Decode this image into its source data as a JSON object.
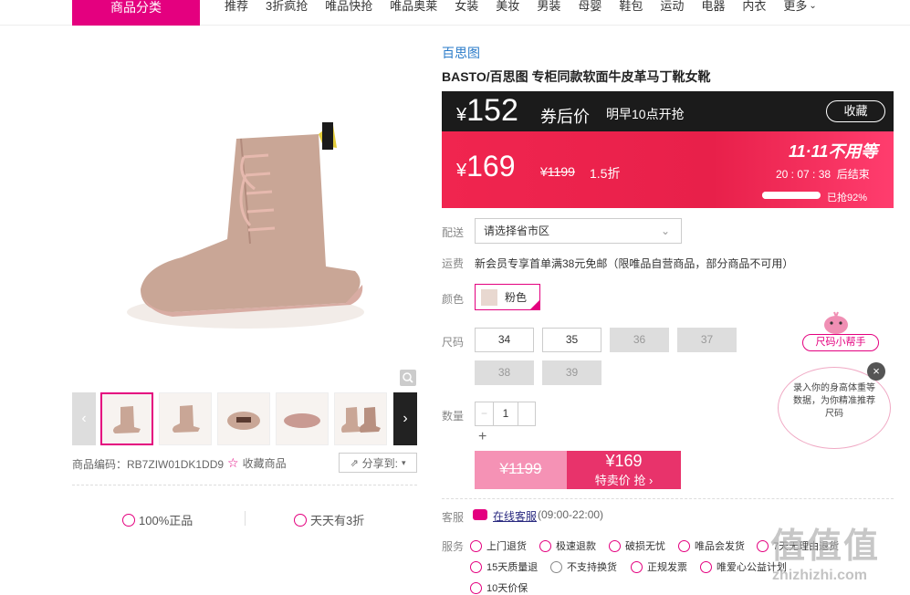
{
  "nav": {
    "category_button": "商品分类",
    "links": [
      "推荐",
      "3折疯抢",
      "唯品快抢",
      "唯品奥莱",
      "女装",
      "美妆",
      "男装",
      "母婴",
      "鞋包",
      "运动",
      "电器",
      "内衣",
      "更多"
    ]
  },
  "product": {
    "brand": "百思图",
    "title": "BASTO/百思图 专柜同款软面牛皮革马丁靴女靴",
    "code_label": "商品编码：",
    "code": "RB7ZIW01DK1DD9",
    "favorite_label": "收藏商品",
    "share_label": "分享到:"
  },
  "price": {
    "coupon_price": "152",
    "coupon_label": "券后价",
    "coupon_start": "明早10点开抢",
    "favorite_btn": "收藏",
    "current_price": "169",
    "currency": "¥",
    "original_price": "¥1199",
    "discount": "1.5折",
    "event_title": "11·11不用等",
    "countdown": "20 : 07 : 38",
    "countdown_suffix": "后结束",
    "sold_label": "已抢92%",
    "sold_fraction": 0.92
  },
  "guarantees": [
    "100%正品",
    "天天有3折"
  ],
  "delivery": {
    "label": "配送",
    "placeholder": "请选择省市区"
  },
  "shipping": {
    "label": "运费",
    "text": "新会员专享首单满38元免邮（限唯品自营商品，部分商品不可用）"
  },
  "color": {
    "label": "颜色",
    "selected": "粉色"
  },
  "sizes": {
    "label": "尺码",
    "options": [
      {
        "value": "34",
        "available": true
      },
      {
        "value": "35",
        "available": true
      },
      {
        "value": "36",
        "available": false
      },
      {
        "value": "37",
        "available": false
      },
      {
        "value": "38",
        "available": false
      },
      {
        "value": "39",
        "available": false
      }
    ]
  },
  "quantity": {
    "label": "数量",
    "value": "1",
    "minus": "−",
    "plus": "+"
  },
  "buy": {
    "original": "¥1199",
    "price": "¥169",
    "action": "特卖价 抢 ›"
  },
  "service": {
    "cs_label": "客服",
    "cs_link": "在线客服",
    "cs_hours": "(09:00-22:00)",
    "svc_label": "服务",
    "items": [
      "上门退货",
      "极速退款",
      "破损无忧",
      "唯品会发货",
      "7天无理由退货",
      "15天质量退",
      "不支持换货",
      "正规发票",
      "唯爱心公益计划",
      "10天价保"
    ]
  },
  "size_helper": {
    "tag": "尺码小帮手",
    "text": "录入你的身高体重等数据，为你精准推荐尺码",
    "close": "×"
  },
  "watermark": {
    "text": "值值值",
    "url": "zhizhizhi.com"
  }
}
